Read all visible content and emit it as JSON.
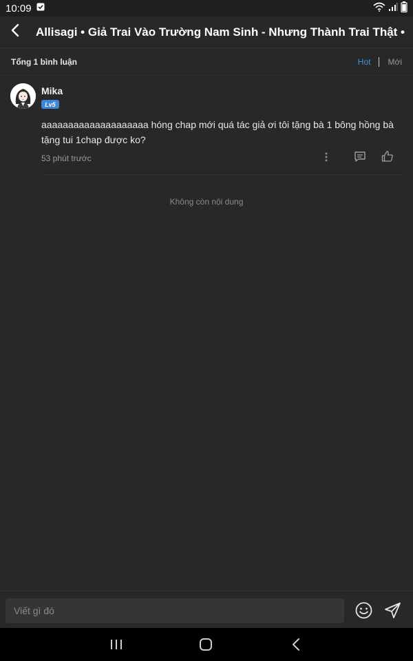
{
  "status_bar": {
    "time": "10:09",
    "icons": [
      "notification-check-icon",
      "wifi-icon",
      "signal-icon",
      "battery-icon"
    ]
  },
  "header": {
    "title": "Allisagi • Giả Trai Vào Trường Nam Sinh - Nhưng Thành Trai Thật •",
    "back_icon": "chevron-left-icon"
  },
  "toolbar": {
    "total_label": "Tổng 1 bình luận",
    "sort_hot": "Hot",
    "sort_new": "Mới",
    "active_sort": "Hot",
    "accent_color": "#4a90d9"
  },
  "comments": [
    {
      "username": "Mika",
      "level": "Lv5",
      "text": "aaaaaaaaaaaaaaaaaaaa hóng chap mới quá tác giả ơi tôi tặng bà 1 bông hồng bà tặng tui 1chap được ko?",
      "time": "53 phút trước",
      "actions": [
        "more-icon",
        "reply-icon",
        "like-icon"
      ]
    }
  ],
  "empty_state": "Không còn nội dung",
  "input": {
    "placeholder": "Viết gì đó",
    "value": "",
    "emoji_icon": "emoji-icon",
    "send_icon": "send-icon"
  },
  "nav_bar": {
    "buttons": [
      "recents-icon",
      "home-icon",
      "back-icon"
    ]
  },
  "colors": {
    "background": "#282828",
    "badge": "#3d86d8",
    "nav_bar": "#000000"
  }
}
